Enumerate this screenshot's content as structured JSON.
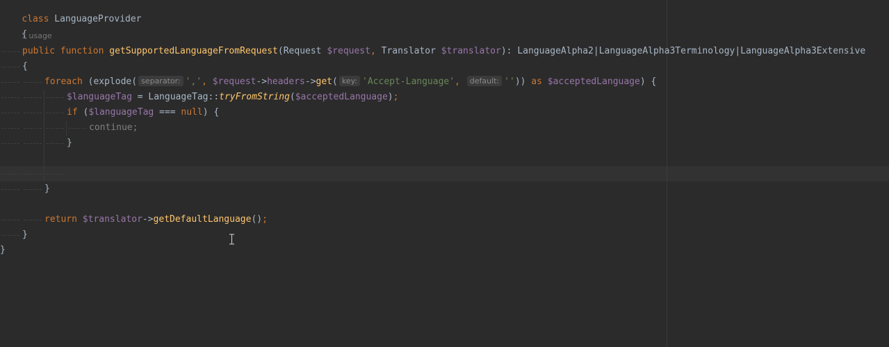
{
  "editor": {
    "usage_hint": "1 usage",
    "lines": {
      "l1": {
        "kw": "class",
        "name": "LanguageProvider"
      },
      "l2": {
        "brace": "{"
      },
      "l3": {
        "kw1": "public",
        "kw2": "function",
        "fn": "getSupportedLanguageFromRequest",
        "p_open": "(",
        "t1": "Request",
        "v1": "$request",
        "comma": ",",
        "t2": "Translator",
        "v2": "$translator",
        "p_close": "):",
        "ret": "LanguageAlpha2|LanguageAlpha3Terminology|LanguageAlpha3Extensive"
      },
      "l4": {
        "brace": "{"
      },
      "l5": {
        "kw": "foreach",
        "open": "(explode(",
        "hint1": "separator:",
        "s1": "','",
        "c1": ",",
        "v1": "$request",
        "arrow1": "->",
        "prop": "headers",
        "arrow2": "->",
        "fn": "get",
        "po": "(",
        "hint2": "key:",
        "s2": "'Accept-Language'",
        "c2": ",",
        "hint3": "default:",
        "s3": "''",
        "close": "))",
        "as": "as",
        "v2": "$acceptedLanguage",
        "end": ") {"
      },
      "l6": {
        "v": "$languageTag",
        "eq": " = ",
        "cls": "LanguageTag",
        "dc": "::",
        "fn": "tryFromString",
        "po": "(",
        "arg": "$acceptedLanguage",
        "pc": ")",
        "semi": ";"
      },
      "l7": {
        "kw": "if",
        "po": " (",
        "v": "$languageTag",
        "op": " === ",
        "null": "null",
        "end": ") {"
      },
      "l8": {
        "text": "continue;"
      },
      "l9": {
        "brace": "}"
      },
      "l11": {
        "brace": "}"
      },
      "l13": {
        "kw": "return",
        "v": "$translator",
        "arrow": "->",
        "fn": "getDefaultLanguage",
        "call": "()",
        "semi": ";"
      },
      "l14": {
        "brace": "}"
      },
      "l15": {
        "brace": "}"
      }
    }
  },
  "colors": {
    "background": "#2b2b2b",
    "keyword": "#cc7832",
    "function": "#ffc66d",
    "variable": "#9876aa",
    "string": "#6a8759",
    "text": "#a9b7c6"
  },
  "icons": {
    "cursor": "text-cursor-icon"
  }
}
